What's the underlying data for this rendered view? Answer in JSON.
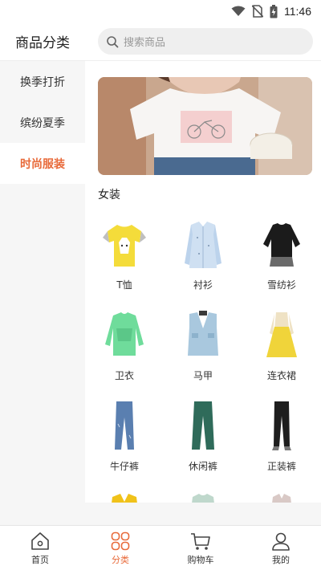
{
  "status_bar": {
    "time": "11:46",
    "icons": [
      "wifi-icon",
      "no-sim-icon",
      "battery-charging-icon"
    ]
  },
  "header": {
    "title": "商品分类",
    "search_placeholder": "搜索商品",
    "search_icon": "search-icon"
  },
  "sidebar": {
    "items": [
      {
        "label": "换季打折",
        "active": false
      },
      {
        "label": "缤纷夏季",
        "active": false
      },
      {
        "label": "时尚服装",
        "active": true
      }
    ]
  },
  "content": {
    "banner_image": "woman-white-tshirt-photo",
    "section_title": "女装",
    "products": [
      {
        "label": "T恤",
        "icon": "tshirt-image"
      },
      {
        "label": "衬衫",
        "icon": "shirt-image"
      },
      {
        "label": "雪纺衫",
        "icon": "chiffon-top-image"
      },
      {
        "label": "卫衣",
        "icon": "sweatshirt-image"
      },
      {
        "label": "马甲",
        "icon": "vest-image"
      },
      {
        "label": "连衣裙",
        "icon": "dress-image"
      },
      {
        "label": "牛仔裤",
        "icon": "jeans-image"
      },
      {
        "label": "休闲裤",
        "icon": "casual-pants-image"
      },
      {
        "label": "正装裤",
        "icon": "dress-pants-image"
      }
    ]
  },
  "tabbar": {
    "items": [
      {
        "label": "首页",
        "icon": "home-icon",
        "active": false
      },
      {
        "label": "分类",
        "icon": "category-grid-icon",
        "active": true
      },
      {
        "label": "购物车",
        "icon": "cart-icon",
        "active": false
      },
      {
        "label": "我的",
        "icon": "user-icon",
        "active": false
      }
    ]
  },
  "colors": {
    "accent": "#e86a3a",
    "sidebar_bg": "#f6f6f6",
    "search_bg": "#efefef"
  }
}
